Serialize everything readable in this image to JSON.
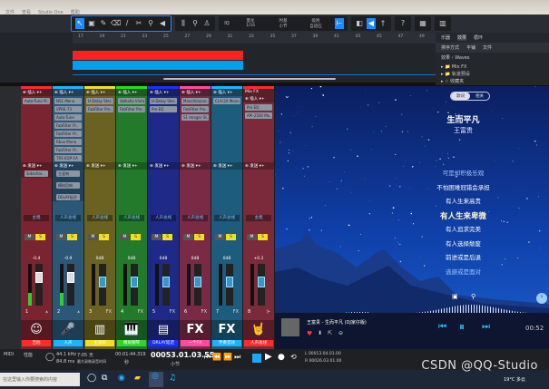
{
  "titlebar": {
    "menus": [
      "文件",
      "查看",
      "Studio One",
      "帮助"
    ]
  },
  "toolbar": {
    "quantize_label": "量化",
    "quantize_value": "1/16",
    "timebase_label": "时基",
    "timebase_value": "小节",
    "snap_label": "吸附",
    "snap_value": "自适应",
    "help": "?"
  },
  "arrange": {
    "ruler": [
      "17",
      "19",
      "21",
      "23",
      "25",
      "27",
      "29",
      "31",
      "33",
      "35",
      "37",
      "39",
      "41",
      "43",
      "45",
      "47",
      "49"
    ],
    "colors": {
      "track1": "#ff2020",
      "track2": "#00a0f0"
    }
  },
  "browser": {
    "tabs": [
      "乐器",
      "效果",
      "循环"
    ],
    "sub": [
      "排序方式",
      "平铺",
      "文件"
    ],
    "path": [
      "效果",
      "Waves"
    ],
    "items": [
      "Mix FX",
      "轨道预设",
      "收藏夹"
    ]
  },
  "channels": [
    {
      "color": "#7a2431",
      "strip": "#ff2a2a",
      "plugins": [
        "Auto-Tune Pr.."
      ],
      "sends": [
        "Sidechai..."
      ],
      "label": "主唱",
      "vol": "-0.4",
      "num": "1",
      "fx": "⩓",
      "icon": "☺",
      "name": "吉他",
      "meter": 0.3,
      "fader": 0.75
    },
    {
      "color": "#2c5878",
      "strip": "#19b4ff",
      "plugins": [
        "NS1 Mono",
        "VPRE-73",
        "Auto-Tune",
        "FabFilter Pr..",
        "FabFilter Pr..",
        "Rbox Mono",
        "FabFilter Pr..",
        "TRS EQP-1A"
      ],
      "sends": [
        "主混响",
        "模拟回响",
        "DELAY延迟"
      ],
      "label": "人声总线",
      "vol": "-0.9",
      "num": "2",
      "fx": "⩓",
      "icon": "🎤",
      "name": "人声",
      "meter": 0.3,
      "fader": 0.75
    },
    {
      "color": "#6b6222",
      "strip": "#f0e020",
      "plugins": [
        "H-Delay Ster..",
        "FabFilter Pro.."
      ],
      "sends": [],
      "label": "人声总线",
      "vol": "0dB",
      "num": "3",
      "fx": "FX",
      "icon": "▥",
      "name": "主混响",
      "meter": 0.0,
      "fader": 0.6
    },
    {
      "color": "#237a2b",
      "strip": "#22dd22",
      "plugins": [
        "Valhalla Vinta..",
        "FabFilter Pro.."
      ],
      "sends": [],
      "label": "人声总线",
      "vol": "0dB",
      "num": "4",
      "fx": "FX",
      "icon": "🎹",
      "name": "模拟钢琴",
      "meter": 0.0,
      "fader": 0.6
    },
    {
      "color": "#1f2a88",
      "strip": "#1a30ff",
      "plugins": [
        "H-Delay Ster..",
        "Pro EQ"
      ],
      "sends": [],
      "label": "人声总线",
      "vol": "0dB",
      "num": "5",
      "fx": "FX",
      "icon": "▤",
      "name": "DRLAY延迟",
      "meter": 0.0,
      "fader": 0.6
    },
    {
      "color": "#7a2a45",
      "strip": "#ff4aa0",
      "plugins": [
        "MaxxVolume..",
        "FabFilter Pro..",
        "S1 Imager St.."
      ],
      "sends": [],
      "label": "人声总线",
      "vol": "0dB",
      "num": "6",
      "fx": "FX",
      "icon": "FX",
      "name": "一个FX",
      "meter": 0.0,
      "fader": 0.6
    },
    {
      "color": "#1e5c7e",
      "strip": "#19b4ff",
      "plugins": [
        "CLA-2A Mono"
      ],
      "sends": [],
      "label": "人声总线",
      "vol": "0dB",
      "num": "7",
      "fx": "FX",
      "icon": "FX",
      "name": "伴奏音效",
      "meter": 0.0,
      "fader": 0.6
    },
    {
      "color": "#7a2a3a",
      "strip": "#ff2a2a",
      "plugins": [
        "Pro EQ",
        "API-2500 Mo.."
      ],
      "sends": [],
      "label": "主唱",
      "vol": "+0.2",
      "num": "8",
      "fx": "⊱",
      "icon": "🤘",
      "name": "人声总线",
      "meter": 0.0,
      "fader": 0.6
    }
  ],
  "mixer": {
    "insert_label": "插入",
    "send_label": "发送",
    "mixfx_label": "Mix FX",
    "mute": "M",
    "solo": "S"
  },
  "player": {
    "tabs": [
      "歌词",
      "相关"
    ],
    "title": "生而平凡",
    "artist": "王富贵",
    "lyrics": [
      "可是却积极乐观",
      "不怕困难冠错会承担",
      "有人生来高贵",
      "有人生来卑微",
      "有人追求完美",
      "有人选择颓废",
      "前进或是后退",
      "逃避或是面对"
    ],
    "current_lyric": 3,
    "now_playing": "王富贵 - 生而平凡 (DJ家仔版)",
    "time": "00:52",
    "progress": 0.28
  },
  "transport": {
    "midi": "MIDI",
    "perf": "性能",
    "sample_rate": "44.1 kHz",
    "latency": "84.8 ms",
    "duration": "7:05 天",
    "duration_label": "最大录制录音时间",
    "clock": "00:01:44.319",
    "clock_unit": "秒",
    "bars": "00053.01.03.55",
    "bars_unit": "小节",
    "loop_l": "00013.04.01.00",
    "loop_r": "00026.03.01.00"
  },
  "taskbar": {
    "search": "在这里输入你要搜索的内容",
    "weather": "19°C 多云"
  },
  "watermark": "CSDN @QQ-Studio"
}
